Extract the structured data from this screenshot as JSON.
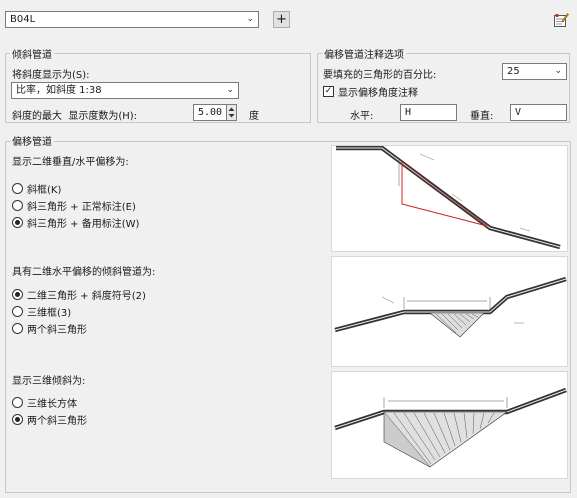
{
  "top": {
    "style_value": "B04L",
    "add_glyph": "+",
    "icon": "sheet-edit-icon"
  },
  "slope_group": {
    "title": "倾斜管道",
    "display_label": "将斜度显示为(S):",
    "display_value": "比率，如斜度 1:38",
    "max_decimals_label": "斜度的最大  显示度数为(H):",
    "max_decimals_value": "5.00",
    "unit": "度"
  },
  "offset_annot_group": {
    "title": "偏移管道注释选项",
    "fill_label": "要填充的三角形的百分比:",
    "fill_value": "25",
    "show_angle_label": "显示偏移角度注释",
    "show_angle_checked": true,
    "horizontal_label": "水平:",
    "horizontal_value": "H",
    "vertical_label": "垂直:",
    "vertical_value": "V"
  },
  "offset_group": {
    "title": "偏移管道",
    "section1": {
      "title": "显示二维垂直/水平偏移为:",
      "options": [
        "斜框(K)",
        "斜三角形 + 正常标注(E)",
        "斜三角形 + 备用标注(W)"
      ],
      "selected": 2
    },
    "section2": {
      "title": "具有二维水平偏移的倾斜管道为:",
      "options": [
        "二维三角形 + 斜度符号(2)",
        "三维框(3)",
        "两个斜三角形"
      ],
      "selected": 0
    },
    "section3": {
      "title": "显示三维倾斜为:",
      "options": [
        "三维长方体",
        "两个斜三角形"
      ],
      "selected": 1
    }
  },
  "colors": {
    "accent_red": "#d42020",
    "frame": "#c8c8c8"
  }
}
